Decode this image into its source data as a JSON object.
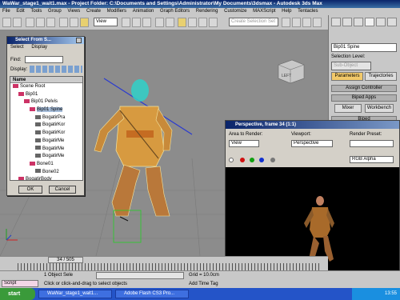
{
  "window": {
    "title": "WaWar_stage1_wait1.max - Project Folder: C:\\Documents and Settings\\Administrator\\My Documents\\3dsmax - Autodesk 3ds Max"
  },
  "menu": [
    "File",
    "Edit",
    "Tools",
    "Group",
    "Views",
    "Create",
    "Modifiers",
    "Animation",
    "Graph Editors",
    "Rendering",
    "Customize",
    "MAXScript",
    "Help",
    "Tentacles"
  ],
  "toolbar": {
    "view_dropdown": "View",
    "selection_set": "Create Selection Set"
  },
  "command_panel": {
    "object_name": "Bip01 Spine",
    "selection_level_label": "Selection Level:",
    "sub_object": "Sub-Object",
    "tab_parameters": "Parameters",
    "tab_trajectories": "Trajectories",
    "assign_controller": "Assign Controller",
    "biped_apps": "Biped Apps",
    "mixer": "Mixer",
    "workbench": "Workbench",
    "biped": "Biped"
  },
  "select_from_scene": {
    "title": "Select From S...",
    "menu": [
      "Select",
      "Display"
    ],
    "find_label": "Find:",
    "display_label": "Display:",
    "column_header": "Name",
    "tree": [
      {
        "label": "Scene Root",
        "depth": 0,
        "selected": false
      },
      {
        "label": "Bip01",
        "depth": 1,
        "selected": false
      },
      {
        "label": "Bip01 Pelvis",
        "depth": 2,
        "selected": false
      },
      {
        "label": "Bip01 Spine",
        "depth": 3,
        "selected": true
      },
      {
        "label": "BogatirPra",
        "depth": 4,
        "selected": false
      },
      {
        "label": "BogatirKor",
        "depth": 4,
        "selected": false
      },
      {
        "label": "BogatirKor",
        "depth": 4,
        "selected": false
      },
      {
        "label": "BogatirMe",
        "depth": 4,
        "selected": false
      },
      {
        "label": "BogatirMe",
        "depth": 4,
        "selected": false
      },
      {
        "label": "BogatirMe",
        "depth": 4,
        "selected": false
      },
      {
        "label": "Bone01",
        "depth": 3,
        "selected": false
      },
      {
        "label": "Bone02",
        "depth": 4,
        "selected": false
      },
      {
        "label": "BogatirBody",
        "depth": 1,
        "selected": false
      }
    ],
    "ok": "OK",
    "cancel": "Cancel"
  },
  "viewcube_label": "LEFT",
  "render_frame": {
    "title": "Perspective, frame 34 (1:1)",
    "area_label": "Area to Render:",
    "area_value": "View",
    "viewport_label": "Viewport:",
    "viewport_value": "Perspective",
    "preset_label": "Render Preset:",
    "channel": "RGB Alpha"
  },
  "timeline": {
    "slider": "34 / 505"
  },
  "status": {
    "script": "Script",
    "selected": "1 Object Sele",
    "prompt": "Click or click-and-drag to select objects",
    "grid": "Grid = 10.0cm",
    "add_time_tag": "Add Time Tag"
  },
  "taskbar": {
    "start": "start",
    "tasks": [
      "WaWar_stage1_wait1...",
      "Adobe Flash CS3 Pro..."
    ],
    "clock": "13:55"
  }
}
